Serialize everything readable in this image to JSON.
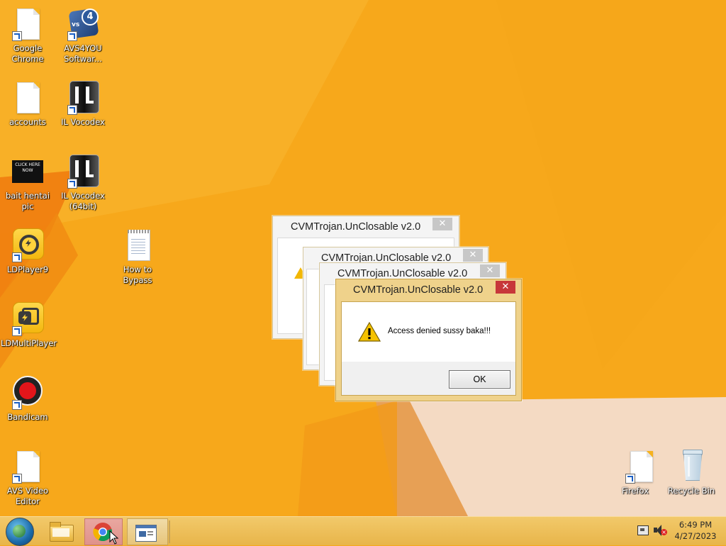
{
  "desktop": {
    "icons": [
      {
        "label": "Google Chrome"
      },
      {
        "label": "AVS4YOU Softwar..."
      },
      {
        "label": "accounts"
      },
      {
        "label": "IL Vocodex"
      },
      {
        "label": "bait hentai pic",
        "thumb_line1": "CLICK HERE",
        "thumb_line2": "NOW"
      },
      {
        "label": "IL Vocodex (64bit)"
      },
      {
        "label": "LDPlayer9"
      },
      {
        "label": "How to Bypass"
      },
      {
        "label": "LDMultiPlayer"
      },
      {
        "label": "Bandicam"
      },
      {
        "label": "AVS Video Editor"
      },
      {
        "label": "Firefox"
      },
      {
        "label": "Recycle Bin"
      }
    ]
  },
  "dialogs": {
    "title": "CVMTrojan.UnClosable v2.0",
    "message": "Access denied sussy baka!!!",
    "ok_label": "OK",
    "close_glyph": "✕"
  },
  "taskbar": {
    "time": "6:49 PM",
    "date": "4/27/2023"
  },
  "colors": {
    "wallpaper": "#f7a81b",
    "dialog_frame_active": "#efd28b",
    "close_active": "#c7373a"
  }
}
